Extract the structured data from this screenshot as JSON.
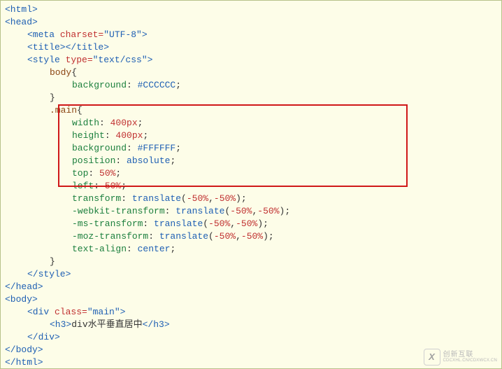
{
  "code": {
    "lines": [
      {
        "cls": "",
        "tokens": [
          {
            "t": "tag",
            "s": "<html>"
          }
        ]
      },
      {
        "cls": "",
        "tokens": [
          {
            "t": "tag",
            "s": "<head>"
          }
        ]
      },
      {
        "cls": "ind1",
        "tokens": [
          {
            "t": "tag",
            "s": "<meta "
          },
          {
            "t": "attr",
            "s": "charset="
          },
          {
            "t": "val",
            "s": "\"UTF-8\""
          },
          {
            "t": "tag",
            "s": ">"
          }
        ]
      },
      {
        "cls": "ind1",
        "tokens": [
          {
            "t": "tag",
            "s": "<title></title>"
          }
        ]
      },
      {
        "cls": "ind1",
        "tokens": [
          {
            "t": "tag",
            "s": "<style "
          },
          {
            "t": "attr",
            "s": "type="
          },
          {
            "t": "val",
            "s": "\"text/css\""
          },
          {
            "t": "tag",
            "s": ">"
          }
        ]
      },
      {
        "cls": "ind2",
        "tokens": [
          {
            "t": "sel",
            "s": "body"
          },
          {
            "t": "punc",
            "s": "{"
          }
        ]
      },
      {
        "cls": "ind3",
        "tokens": [
          {
            "t": "prop",
            "s": "background"
          },
          {
            "t": "punc",
            "s": ": "
          },
          {
            "t": "pv",
            "s": "#CCCCCC"
          },
          {
            "t": "punc",
            "s": ";"
          }
        ]
      },
      {
        "cls": "ind2",
        "tokens": [
          {
            "t": "punc",
            "s": "}"
          }
        ]
      },
      {
        "cls": "ind2",
        "tokens": [
          {
            "t": "sel",
            "s": ".main"
          },
          {
            "t": "punc",
            "s": "{"
          }
        ]
      },
      {
        "cls": "ind3",
        "tokens": [
          {
            "t": "prop",
            "s": "width"
          },
          {
            "t": "punc",
            "s": ": "
          },
          {
            "t": "num",
            "s": "400px"
          },
          {
            "t": "punc",
            "s": ";"
          }
        ]
      },
      {
        "cls": "ind3",
        "tokens": [
          {
            "t": "prop",
            "s": "height"
          },
          {
            "t": "punc",
            "s": ": "
          },
          {
            "t": "num",
            "s": "400px"
          },
          {
            "t": "punc",
            "s": ";"
          }
        ]
      },
      {
        "cls": "ind3",
        "tokens": [
          {
            "t": "prop",
            "s": "background"
          },
          {
            "t": "punc",
            "s": ": "
          },
          {
            "t": "pv",
            "s": "#FFFFFF"
          },
          {
            "t": "punc",
            "s": ";"
          }
        ]
      },
      {
        "cls": "ind3",
        "tokens": [
          {
            "t": "prop",
            "s": "position"
          },
          {
            "t": "punc",
            "s": ": "
          },
          {
            "t": "pv",
            "s": "absolute"
          },
          {
            "t": "punc",
            "s": ";"
          }
        ]
      },
      {
        "cls": "ind3",
        "tokens": [
          {
            "t": "prop",
            "s": "top"
          },
          {
            "t": "punc",
            "s": ": "
          },
          {
            "t": "num",
            "s": "50%"
          },
          {
            "t": "punc",
            "s": ";"
          }
        ]
      },
      {
        "cls": "ind3",
        "tokens": [
          {
            "t": "prop",
            "s": "left"
          },
          {
            "t": "punc",
            "s": ": "
          },
          {
            "t": "num",
            "s": "50%"
          },
          {
            "t": "punc",
            "s": ";"
          }
        ]
      },
      {
        "cls": "ind3",
        "tokens": [
          {
            "t": "prop",
            "s": "transform"
          },
          {
            "t": "punc",
            "s": ": "
          },
          {
            "t": "pv",
            "s": "translate"
          },
          {
            "t": "punc",
            "s": "("
          },
          {
            "t": "num",
            "s": "-50%"
          },
          {
            "t": "punc",
            "s": ","
          },
          {
            "t": "num",
            "s": "-50%"
          },
          {
            "t": "punc",
            "s": ");"
          }
        ]
      },
      {
        "cls": "ind3",
        "tokens": [
          {
            "t": "prop",
            "s": "-webkit-transform"
          },
          {
            "t": "punc",
            "s": ": "
          },
          {
            "t": "pv",
            "s": "translate"
          },
          {
            "t": "punc",
            "s": "("
          },
          {
            "t": "num",
            "s": "-50%"
          },
          {
            "t": "punc",
            "s": ","
          },
          {
            "t": "num",
            "s": "-50%"
          },
          {
            "t": "punc",
            "s": ");"
          }
        ]
      },
      {
        "cls": "ind3",
        "tokens": [
          {
            "t": "prop",
            "s": "-ms-transform"
          },
          {
            "t": "punc",
            "s": ": "
          },
          {
            "t": "pv",
            "s": "translate"
          },
          {
            "t": "punc",
            "s": "("
          },
          {
            "t": "num",
            "s": "-50%"
          },
          {
            "t": "punc",
            "s": ","
          },
          {
            "t": "num",
            "s": "-50%"
          },
          {
            "t": "punc",
            "s": ");"
          }
        ]
      },
      {
        "cls": "ind3",
        "tokens": [
          {
            "t": "prop",
            "s": "-moz-transform"
          },
          {
            "t": "punc",
            "s": ": "
          },
          {
            "t": "pv",
            "s": "translate"
          },
          {
            "t": "punc",
            "s": "("
          },
          {
            "t": "num",
            "s": "-50%"
          },
          {
            "t": "punc",
            "s": ","
          },
          {
            "t": "num",
            "s": "-50%"
          },
          {
            "t": "punc",
            "s": ");"
          }
        ]
      },
      {
        "cls": "ind3",
        "tokens": [
          {
            "t": "prop",
            "s": "text-align"
          },
          {
            "t": "punc",
            "s": ": "
          },
          {
            "t": "pv",
            "s": "center"
          },
          {
            "t": "punc",
            "s": ";"
          }
        ]
      },
      {
        "cls": "ind2",
        "tokens": [
          {
            "t": "punc",
            "s": "}"
          }
        ]
      },
      {
        "cls": "ind1",
        "tokens": [
          {
            "t": "tag",
            "s": "</style>"
          }
        ]
      },
      {
        "cls": "",
        "tokens": [
          {
            "t": "tag",
            "s": "</head>"
          }
        ]
      },
      {
        "cls": "",
        "tokens": [
          {
            "t": "tag",
            "s": "<body>"
          }
        ]
      },
      {
        "cls": "ind1",
        "tokens": [
          {
            "t": "tag",
            "s": "<div "
          },
          {
            "t": "attr",
            "s": "class="
          },
          {
            "t": "val",
            "s": "\"main\""
          },
          {
            "t": "tag",
            "s": ">"
          }
        ]
      },
      {
        "cls": "ind2",
        "tokens": [
          {
            "t": "tag",
            "s": "<h3>"
          },
          {
            "t": "txt",
            "s": "div水平垂直居中"
          },
          {
            "t": "tag",
            "s": "</h3>"
          }
        ]
      },
      {
        "cls": "ind1",
        "tokens": [
          {
            "t": "tag",
            "s": "</div>"
          }
        ]
      },
      {
        "cls": "",
        "tokens": [
          {
            "t": "tag",
            "s": "</body>"
          }
        ]
      },
      {
        "cls": "",
        "tokens": [
          {
            "t": "tag",
            "s": "</html>"
          }
        ]
      }
    ]
  },
  "watermark": {
    "logo": "X",
    "cn": "创新互联",
    "en": "CDCXHL.CN/CDXWCX.CN"
  }
}
